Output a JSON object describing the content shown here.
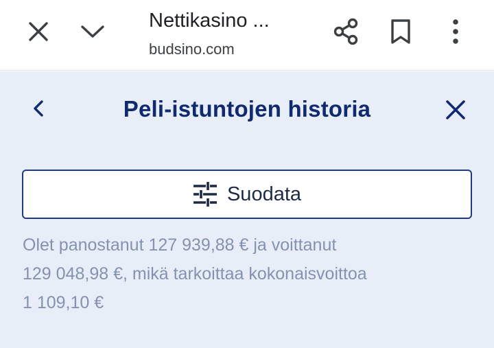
{
  "browser": {
    "title": "Nettikasino ...",
    "domain": "budsino.com",
    "icons": [
      "close-icon",
      "chevron-down-icon",
      "share-icon",
      "bookmark-icon",
      "more-vert-icon"
    ]
  },
  "panel": {
    "title": "Peli-istuntojen historia",
    "filter_label": "Suodata",
    "summary_line1": "Olet panostanut 127 939,88 € ja voittanut",
    "summary_line2": "129 048,98 €, mikä tarkoittaa kokonaisvoittoa",
    "summary_line3": "1 109,10 €",
    "icons": [
      "back-chevron-icon",
      "close-icon",
      "tune-icon"
    ]
  },
  "colors": {
    "panel_bg": "#e8eef8",
    "title": "#0f2a6e",
    "button_border": "#1e3a86",
    "summary_text": "#8591b0"
  }
}
